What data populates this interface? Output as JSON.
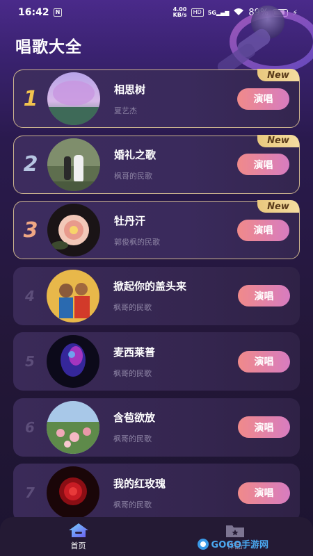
{
  "status_bar": {
    "time": "16:42",
    "net_speed": "4.00",
    "net_unit": "KB/s",
    "signal_label": "5G",
    "battery": "89%"
  },
  "header": {
    "title": "唱歌大全"
  },
  "songs": [
    {
      "rank": "1",
      "title": "相思树",
      "artist": "夏艺杰",
      "button": "演唱",
      "tag": "New"
    },
    {
      "rank": "2",
      "title": "婚礼之歌",
      "artist": "枫哥的民歌",
      "button": "演唱",
      "tag": "New"
    },
    {
      "rank": "3",
      "title": "牡丹汗",
      "artist": "郭俊枫的民歌",
      "button": "演唱",
      "tag": "New"
    },
    {
      "rank": "4",
      "title": "掀起你的盖头来",
      "artist": "枫哥的民歌",
      "button": "演唱"
    },
    {
      "rank": "5",
      "title": "麦西莱普",
      "artist": "枫哥的民歌",
      "button": "演唱"
    },
    {
      "rank": "6",
      "title": "含苞欲放",
      "artist": "枫哥的民歌",
      "button": "演唱"
    },
    {
      "rank": "7",
      "title": "我的红玫瑰",
      "artist": "枫哥的民歌",
      "button": "演唱"
    }
  ],
  "bottom_nav": {
    "home": "首页",
    "works": "作品"
  },
  "watermark": {
    "text": "GOGO手游网"
  },
  "colors": {
    "accent_button_start": "#f08a8a",
    "accent_button_end": "#d77cc0",
    "new_tag": "#e9c87e"
  }
}
